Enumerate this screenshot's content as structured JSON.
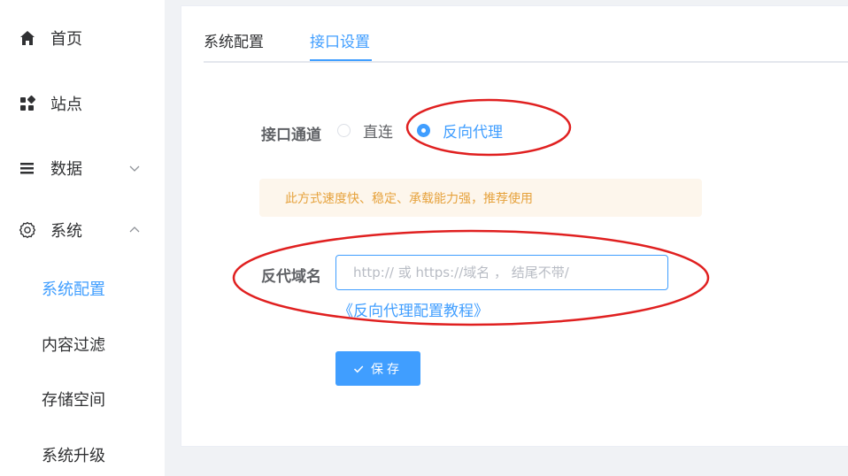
{
  "sidebar": {
    "items": [
      {
        "label": "首页",
        "icon": "home-icon"
      },
      {
        "label": "站点",
        "icon": "apps-icon"
      },
      {
        "label": "数据",
        "icon": "list-icon"
      },
      {
        "label": "系统",
        "icon": "gear-icon"
      }
    ],
    "sub_items": [
      {
        "label": "系统配置",
        "active": true
      },
      {
        "label": "内容过滤"
      },
      {
        "label": "存储空间"
      },
      {
        "label": "系统升级"
      }
    ]
  },
  "tabs": [
    {
      "label": "系统配置"
    },
    {
      "label": "接口设置",
      "active": true
    }
  ],
  "form": {
    "channel_label": "接口通道",
    "channel_options": [
      {
        "label": "直连",
        "checked": false
      },
      {
        "label": "反向代理",
        "checked": true
      }
    ],
    "notice": "此方式速度快、稳定、承载能力强，推荐使用",
    "domain_label": "反代域名",
    "domain_value": "",
    "domain_placeholder": "http:// 或 https://域名 ， 结尾不带/",
    "tutorial_link": "《反向代理配置教程》",
    "save_label": "保存"
  },
  "colors": {
    "accent": "#409eff",
    "warning_bg": "#fdf6ec",
    "warning_text": "#e6a23c",
    "annotation": "#e02020"
  }
}
